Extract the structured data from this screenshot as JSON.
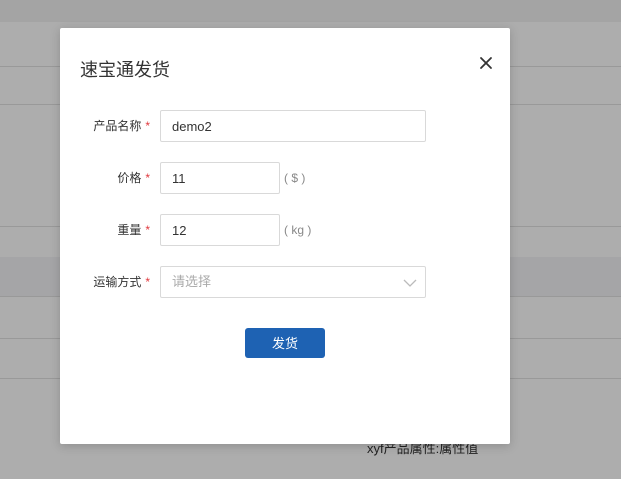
{
  "background": {
    "cell_text": "xyf产品属性:属性值"
  },
  "dialog": {
    "title": "速宝通发货",
    "close_icon": "close-icon",
    "fields": {
      "product_name": {
        "label": "产品名称",
        "required_mark": "*",
        "value": "demo2"
      },
      "price": {
        "label": "价格",
        "required_mark": "*",
        "value": "11",
        "unit": "( $ )"
      },
      "weight": {
        "label": "重量",
        "required_mark": "*",
        "value": "12",
        "unit": "( kg )"
      },
      "shipping_method": {
        "label": "运输方式",
        "required_mark": "*",
        "placeholder": "请选择",
        "arrow_icon": "chevron-down-icon"
      }
    },
    "submit_label": "发货"
  },
  "colors": {
    "primary_button": "#1e62b3",
    "required_mark": "#e0393e",
    "overlay": "rgba(0,0,0,0.32)"
  }
}
